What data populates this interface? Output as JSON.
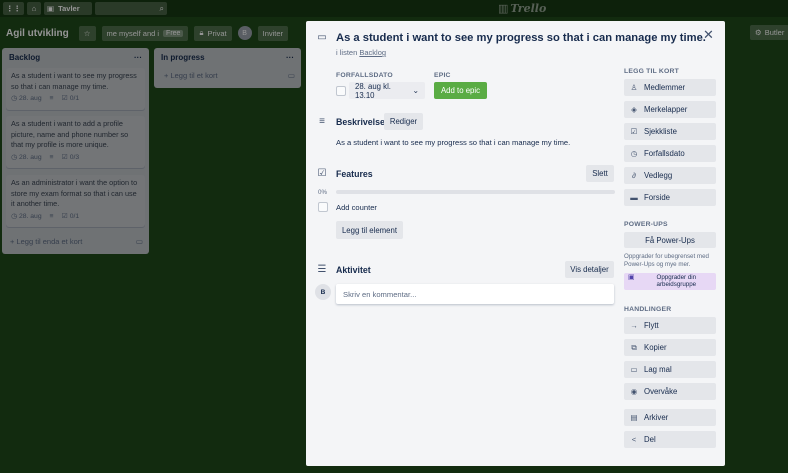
{
  "topbar": {
    "boards_label": "Tavler",
    "logo_text": "Trello"
  },
  "board": {
    "title": "Agil utvikling",
    "team_label": "me myself and i",
    "team_badge": "Free",
    "privacy_label": "Privat",
    "invite_label": "Inviter",
    "butler_label": "Butler"
  },
  "lists": [
    {
      "title": "Backlog",
      "cards": [
        {
          "text": "As a student i want to see my progress so that i can manage my time.",
          "date": "28. aug",
          "checklist": "0/1"
        },
        {
          "text": "As a student i want to add a profile picture, name and phone number so that my profile is more unique.",
          "date": "28. aug",
          "checklist": "0/3"
        },
        {
          "text": "As an administrator i want the option to store my exam format so that i can use it another time.",
          "date": "28. aug",
          "checklist": "0/1"
        }
      ],
      "add_label": "Legg til enda et kort"
    },
    {
      "title": "In progress",
      "cards": [],
      "add_label": "Legg til et kort"
    }
  ],
  "modal": {
    "title": "As a student i want to see my progress so that i can manage my time.",
    "in_list_prefix": "i listen",
    "list_name": "Backlog",
    "due_label": "FORFALLSDATO",
    "due_value": "28. aug kl. 13.10",
    "epic_label": "EPIC",
    "epic_button": "Add to epic",
    "description_title": "Beskrivelse",
    "edit_button": "Rediger",
    "description_text": "As a student i want to see my progress so that i can manage my time.",
    "checklist_title": "Features",
    "delete_button": "Slett",
    "progress_label": "0%",
    "progress_value": 0,
    "checklist_items": [
      "Add counter"
    ],
    "add_item_button": "Legg til element",
    "activity_title": "Aktivitet",
    "details_button": "Vis detaljer",
    "comment_placeholder": "Skriv en kommentar...",
    "avatar_initial": "B"
  },
  "sidebar": {
    "add_to_card_label": "LEGG TIL KORT",
    "add_items": [
      {
        "label": "Medlemmer",
        "icon": "person-icon"
      },
      {
        "label": "Merkelapper",
        "icon": "tag-icon"
      },
      {
        "label": "Sjekkliste",
        "icon": "checklist-icon"
      },
      {
        "label": "Forfallsdato",
        "icon": "clock-icon"
      },
      {
        "label": "Vedlegg",
        "icon": "paperclip-icon"
      },
      {
        "label": "Forside",
        "icon": "cover-icon"
      }
    ],
    "powerups_label": "POWER-UPS",
    "powerups_button": "Få Power-Ups",
    "powerups_text": "Oppgrader for ubegrenset med Power-Ups og mye mer.",
    "upgrade_button": "Oppgrader din arbeidsgruppe",
    "actions_label": "HANDLINGER",
    "actions": [
      {
        "label": "Flytt",
        "icon": "arrow-right-icon"
      },
      {
        "label": "Kopier",
        "icon": "copy-icon"
      },
      {
        "label": "Lag mal",
        "icon": "template-icon"
      },
      {
        "label": "Overvåke",
        "icon": "eye-icon"
      },
      {
        "label": "Arkiver",
        "icon": "archive-icon"
      },
      {
        "label": "Del",
        "icon": "share-icon"
      }
    ]
  }
}
